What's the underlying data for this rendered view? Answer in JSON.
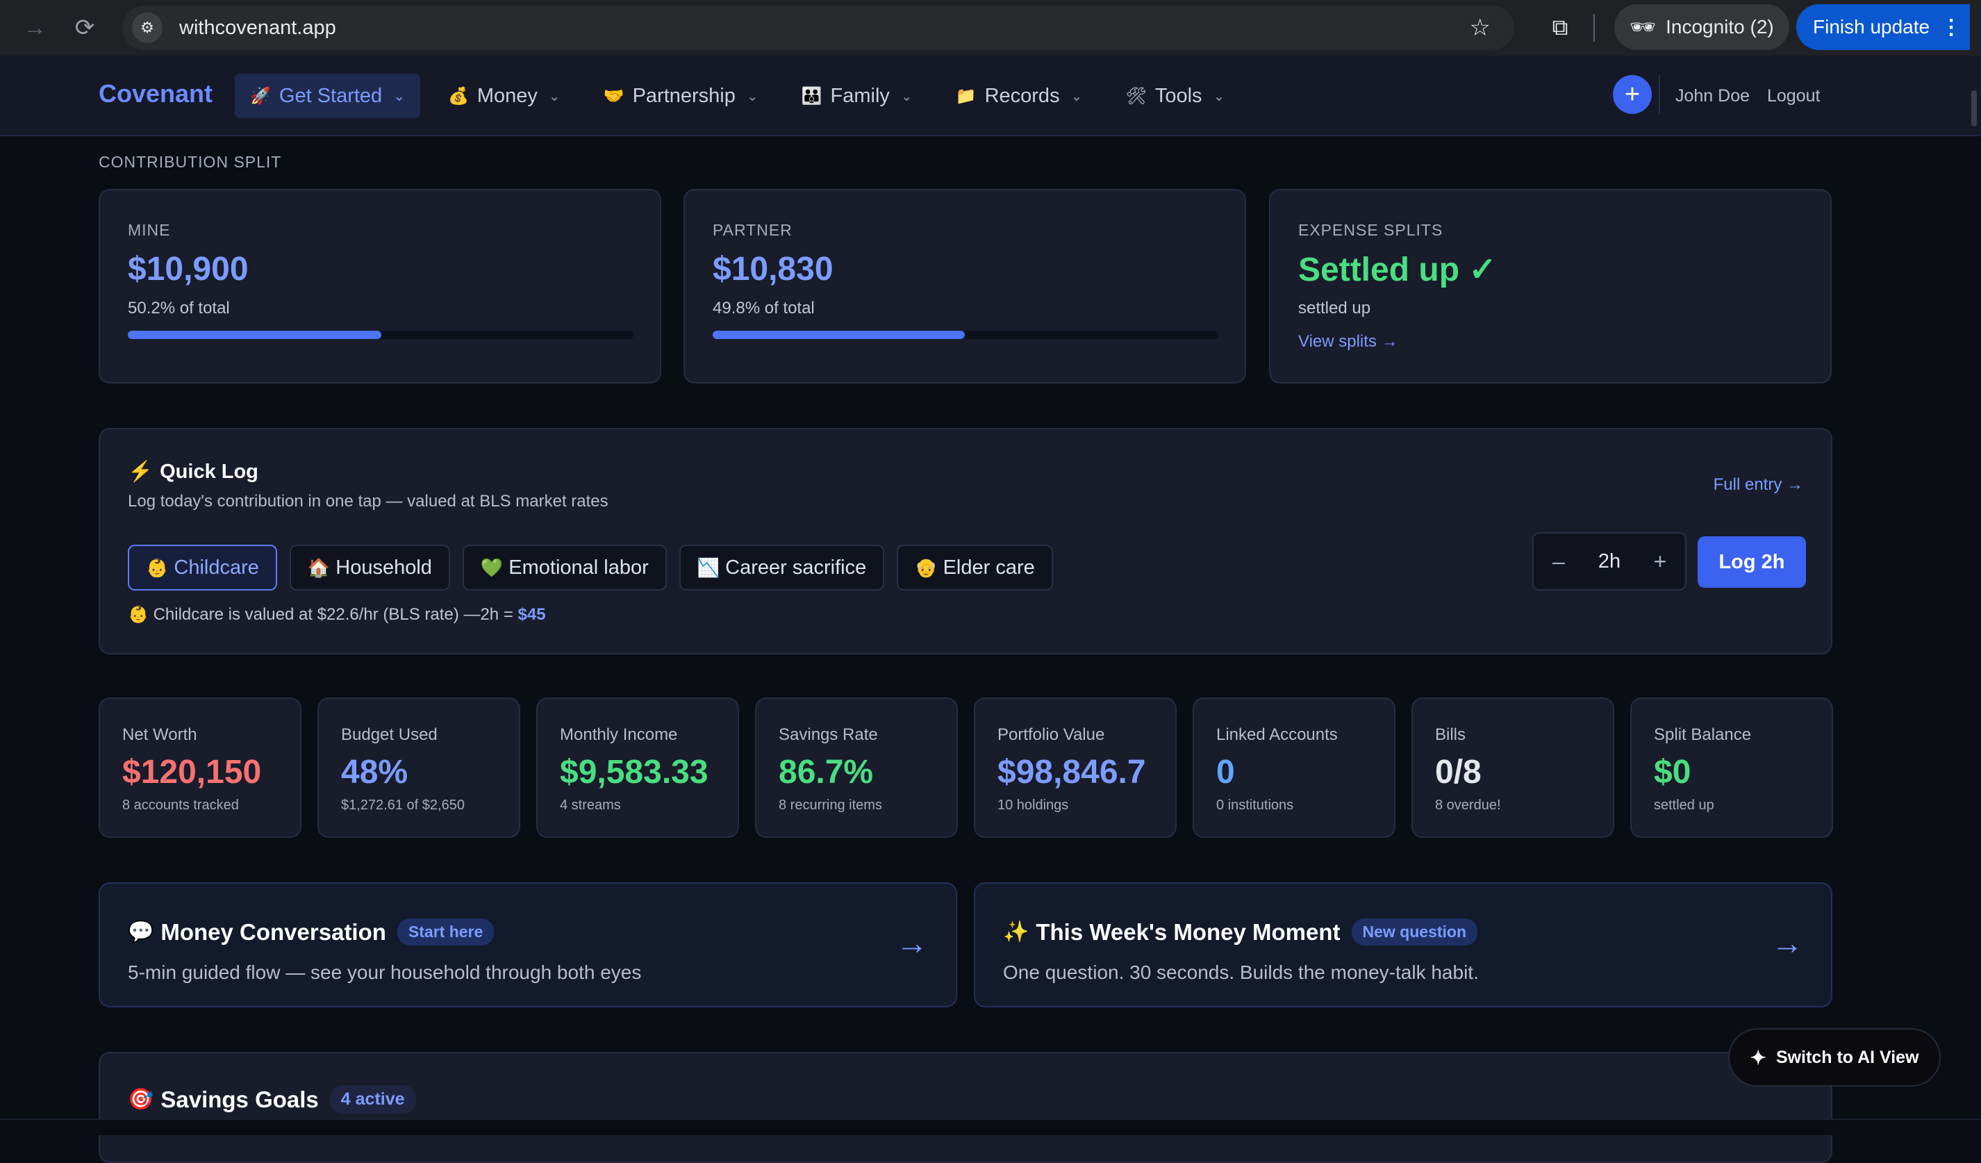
{
  "browser": {
    "url": "withcovenant.app",
    "incognito_label": "Incognito (2)",
    "finish_update_label": "Finish update",
    "icons": [
      "forward-icon",
      "reload-icon",
      "site-settings-icon",
      "star-icon",
      "cast-icon",
      "incognito-icon",
      "more-icon"
    ]
  },
  "nav": {
    "brand": "Covenant",
    "items": [
      {
        "emoji": "🚀",
        "label": "Get Started",
        "active": true
      },
      {
        "emoji": "💰",
        "label": "Money"
      },
      {
        "emoji": "🤝",
        "label": "Partnership"
      },
      {
        "emoji": "👪",
        "label": "Family"
      },
      {
        "emoji": "📁",
        "label": "Records"
      },
      {
        "emoji": "🛠",
        "label": "Tools"
      }
    ],
    "user": "John Doe",
    "logout": "Logout",
    "plus": "+"
  },
  "contribution": {
    "section_label": "CONTRIBUTION SPLIT",
    "mine": {
      "label": "MINE",
      "value": "$10,900",
      "sub": "50.2% of total",
      "share": 0.502
    },
    "partner": {
      "label": "PARTNER",
      "value": "$10,830",
      "sub": "49.8% of total",
      "share": 0.498
    },
    "expense": {
      "label": "EXPENSE SPLITS",
      "value": "Settled up ✓",
      "sub": "settled up",
      "link": "View splits →"
    }
  },
  "quick_log": {
    "emoji": "⚡",
    "title": "Quick Log",
    "subtitle": "Log today's contribution in one tap — valued at BLS market rates",
    "full_entry": "Full entry →",
    "chips": [
      {
        "emoji": "👶",
        "label": "Childcare",
        "active": true
      },
      {
        "emoji": "🏠",
        "label": "Household"
      },
      {
        "emoji": "💚",
        "label": "Emotional labor"
      },
      {
        "emoji": "📉",
        "label": "Career sacrifice"
      },
      {
        "emoji": "👴",
        "label": "Elder care"
      }
    ],
    "note_emoji": "👶",
    "note_text": "Childcare is valued at $22.6/hr (BLS rate) —2h = ",
    "note_amount": "$45",
    "stepper": {
      "minus": "–",
      "value": "2h",
      "plus": "+"
    },
    "log_button": "Log 2h"
  },
  "stats": [
    {
      "label": "Net Worth",
      "value": "$120,150",
      "sub": "8 accounts tracked",
      "color": "#f87171"
    },
    {
      "label": "Budget Used",
      "value": "48%",
      "sub": "$1,272.61 of $2,650",
      "color": "#7c9cff"
    },
    {
      "label": "Monthly Income",
      "value": "$9,583.33",
      "sub": "4 streams",
      "color": "#4ade80"
    },
    {
      "label": "Savings Rate",
      "value": "86.7%",
      "sub": "8 recurring items",
      "color": "#4ade80"
    },
    {
      "label": "Portfolio Value",
      "value": "$98,846.7",
      "sub": "10 holdings",
      "color": "#7c9cff"
    },
    {
      "label": "Linked Accounts",
      "value": "0",
      "sub": "0 institutions",
      "color": "#60a5fa"
    },
    {
      "label": "Bills",
      "value": "0/8",
      "sub": "8 overdue!",
      "color": "#e5e7eb"
    },
    {
      "label": "Split Balance",
      "value": "$0",
      "sub": "settled up",
      "color": "#4ade80"
    }
  ],
  "promos": [
    {
      "emoji": "💬",
      "title": "Money Conversation",
      "badge": "Start here",
      "desc": "5-min guided flow — see your household through both eyes",
      "arrow": "→"
    },
    {
      "emoji": "✨",
      "title": "This Week's Money Moment",
      "badge": "New question",
      "desc": "One question. 30 seconds. Builds the money-talk habit.",
      "arrow": "→"
    }
  ],
  "savings_goals": {
    "emoji": "🎯",
    "title": "Savings Goals",
    "badge": "4 active"
  },
  "ai_view": {
    "emoji": "✦",
    "label": "Switch to AI View"
  }
}
